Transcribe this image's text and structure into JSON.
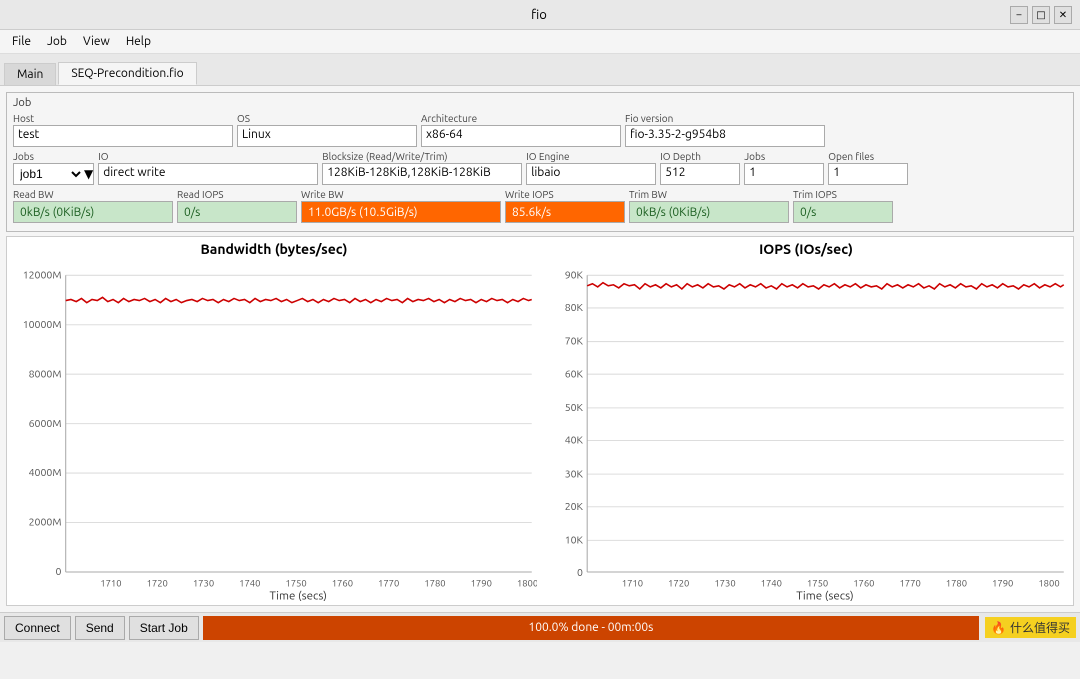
{
  "titlebar": {
    "title": "fio",
    "minimize_label": "–",
    "maximize_label": "□",
    "close_label": "✕"
  },
  "menubar": {
    "items": [
      "File",
      "Job",
      "View",
      "Help"
    ]
  },
  "tabs": {
    "main_label": "Main",
    "precondition_label": "SEQ-Precondition.fio"
  },
  "job_section": {
    "label": "Job",
    "host_label": "Host",
    "host_value": "test",
    "os_label": "OS",
    "os_value": "Linux",
    "arch_label": "Architecture",
    "arch_value": "x86-64",
    "fio_label": "Fio version",
    "fio_value": "fio-3.35-2-g954b8",
    "jobs_label": "Jobs",
    "jobs_value": "job1",
    "io_label": "IO",
    "io_value": "direct write",
    "blocksize_label": "Blocksize (Read/Write/Trim)",
    "blocksize_value": "128KiB-128KiB,128KiB-128KiB",
    "ioengine_label": "IO Engine",
    "ioengine_value": "libaio",
    "iodepth_label": "IO Depth",
    "iodepth_value": "512",
    "jobs2_label": "Jobs",
    "jobs2_value": "1",
    "openfiles_label": "Open files",
    "openfiles_value": "1"
  },
  "stats": {
    "read_bw_label": "Read BW",
    "read_bw_value": "0kB/s (0KiB/s)",
    "read_iops_label": "Read IOPS",
    "read_iops_value": "0/s",
    "write_bw_label": "Write BW",
    "write_bw_value": "11.0GB/s (10.5GiB/s)",
    "write_iops_label": "Write IOPS",
    "write_iops_value": "85.6k/s",
    "trim_bw_label": "Trim BW",
    "trim_bw_value": "0kB/s (0KiB/s)",
    "trim_iops_label": "Trim IOPS",
    "trim_iops_value": "0/s"
  },
  "charts": {
    "bw_title": "Bandwidth (bytes/sec)",
    "iops_title": "IOPS (IOs/sec)",
    "bw_y_labels": [
      "12000M",
      "10000M",
      "8000M",
      "6000M",
      "4000M",
      "2000M",
      "0"
    ],
    "iops_y_labels": [
      "90K",
      "80K",
      "70K",
      "60K",
      "50K",
      "40K",
      "30K",
      "20K",
      "10K",
      "0"
    ],
    "x_labels": [
      "1710",
      "1720",
      "1730",
      "1740",
      "1750",
      "1760",
      "1770",
      "1780",
      "1790",
      "1800"
    ],
    "x_axis_label": "Time (secs)",
    "bw_avg": 11000000000,
    "iops_avg": 85600
  },
  "bottom": {
    "connect_label": "Connect",
    "send_label": "Send",
    "start_job_label": "Start Job",
    "status_text": "100.0% done - 00m:00s",
    "watermark_text": "什么值得买"
  }
}
